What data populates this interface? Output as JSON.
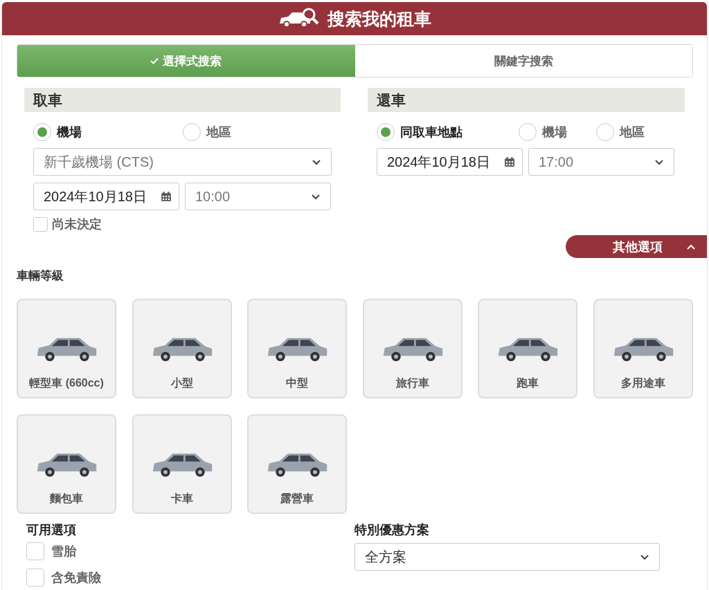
{
  "header": {
    "title": "搜索我的租車"
  },
  "tabs": [
    {
      "label": "選擇式搜索",
      "selected": true
    },
    {
      "label": "關鍵字搜索",
      "selected": false
    }
  ],
  "pickup": {
    "heading": "取車",
    "location_options": [
      {
        "label": "機場",
        "selected": true
      },
      {
        "label": "地區",
        "selected": false
      }
    ],
    "location_select": {
      "value": "新千歲機場 (CTS)"
    },
    "date": "2024年10月18日",
    "time": "10:00",
    "undecided": {
      "label": "尚未決定",
      "checked": false
    }
  },
  "return": {
    "heading": "還車",
    "location_options": [
      {
        "label": "同取車地點",
        "selected": true
      },
      {
        "label": "機場",
        "selected": false
      },
      {
        "label": "地區",
        "selected": false
      }
    ],
    "date": "2024年10月18日",
    "time": "17:00"
  },
  "more_options": {
    "label": "其他選項",
    "expanded": true
  },
  "vehicle_class": {
    "heading": "車輛等級",
    "items": [
      {
        "label": "輕型車 (660cc)"
      },
      {
        "label": "小型"
      },
      {
        "label": "中型"
      },
      {
        "label": "旅行車"
      },
      {
        "label": "跑車"
      },
      {
        "label": "多用途車"
      },
      {
        "label": "麵包車"
      },
      {
        "label": "卡車"
      },
      {
        "label": "露營車"
      }
    ]
  },
  "extras": {
    "heading": "可用選項",
    "options": [
      {
        "label": "雪胎",
        "checked": false
      },
      {
        "label": "含免責險",
        "checked": false
      }
    ]
  },
  "special_plan": {
    "heading": "特別優惠方案",
    "value": "全方案"
  }
}
